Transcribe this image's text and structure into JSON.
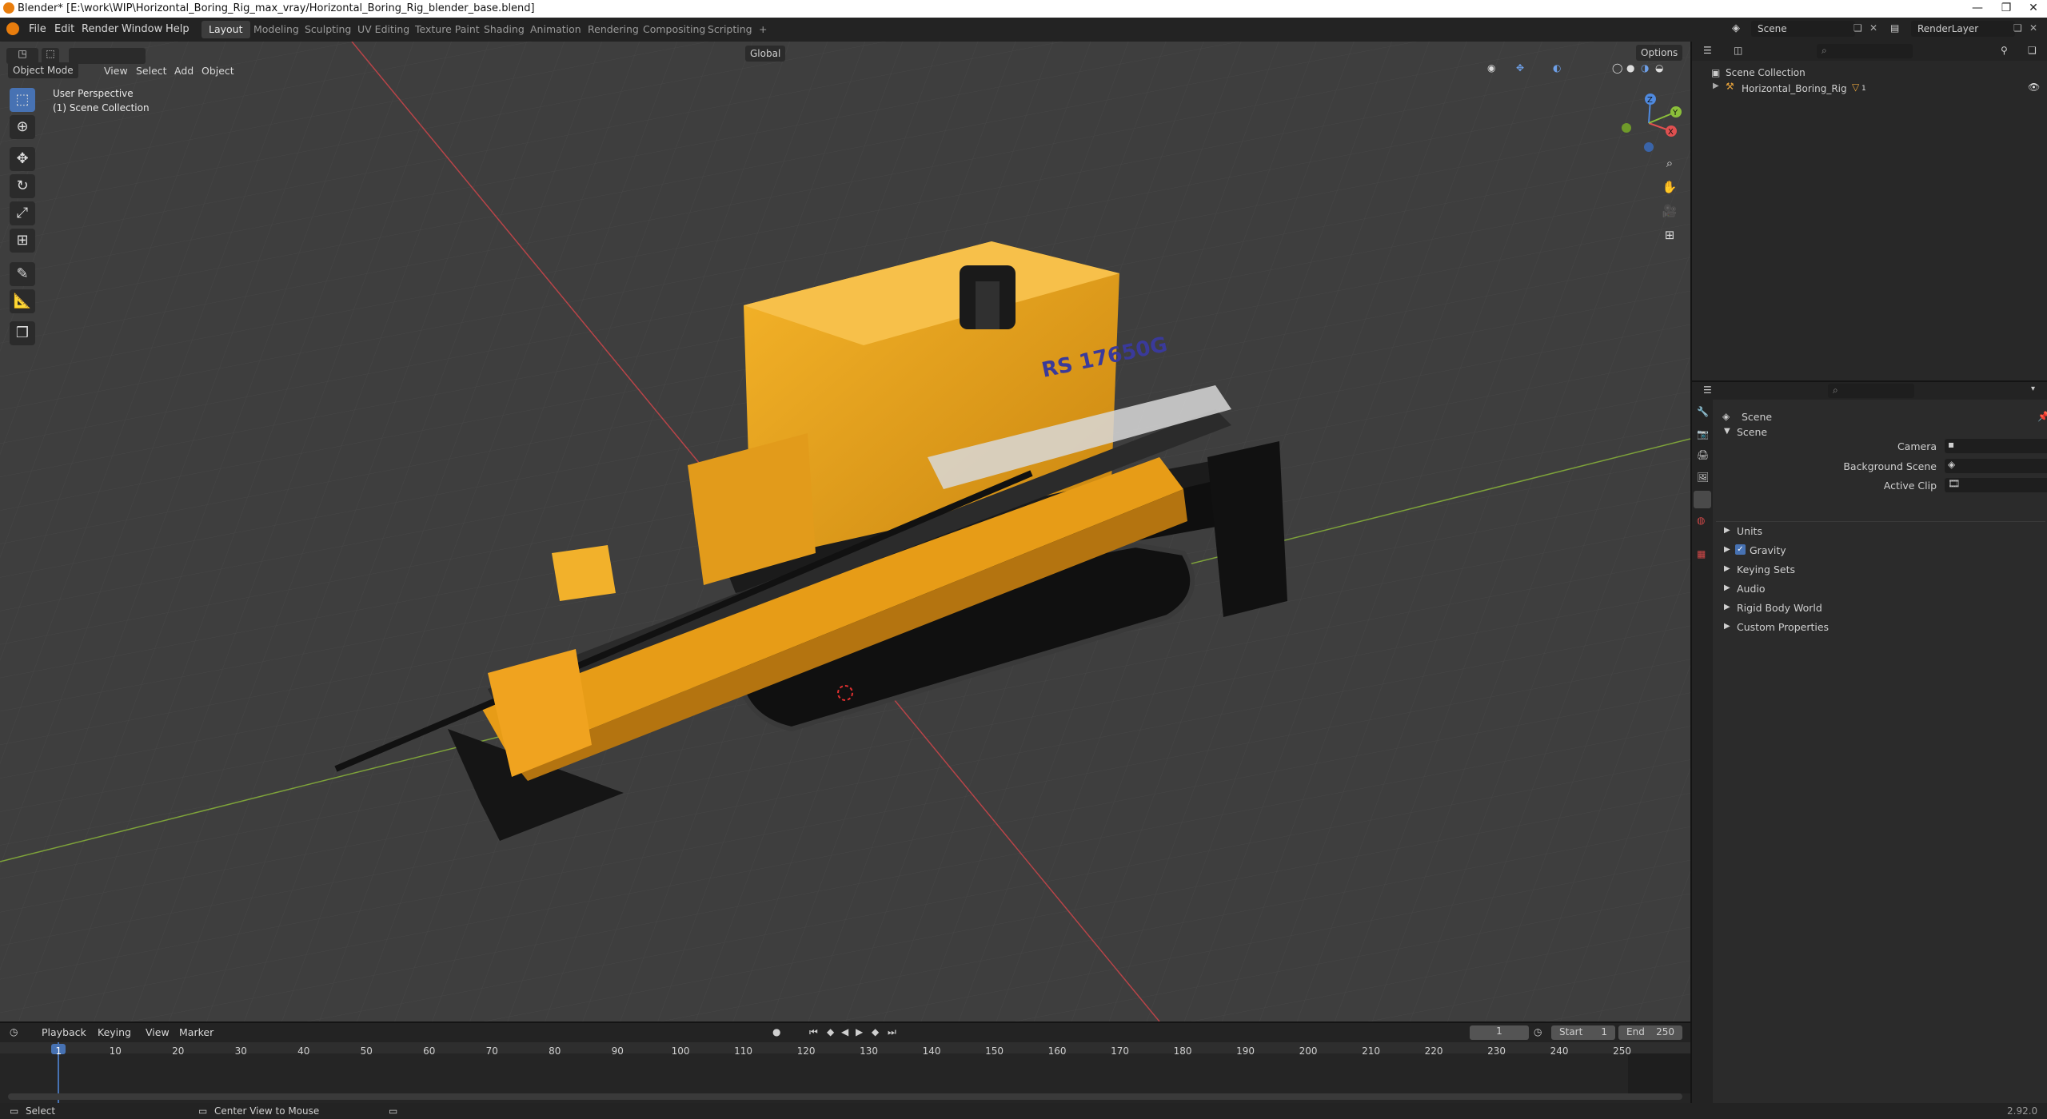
{
  "titlebar": {
    "title": "Blender* [E:\\work\\WIP\\Horizontal_Boring_Rig_max_vray/Horizontal_Boring_Rig_blender_base.blend]",
    "minimize": "—",
    "maximize": "❐",
    "close": "✕"
  },
  "menu": [
    "File",
    "Edit",
    "Render",
    "Window",
    "Help"
  ],
  "workspaces": [
    "Layout",
    "Modeling",
    "Sculpting",
    "UV Editing",
    "Texture Paint",
    "Shading",
    "Animation",
    "Rendering",
    "Compositing",
    "Scripting",
    "+"
  ],
  "scene_name": "Scene",
  "view_layer": "RenderLayer",
  "viewport": {
    "mode": "Object Mode",
    "menus": [
      "View",
      "Select",
      "Add",
      "Object"
    ],
    "orientation": "Global",
    "options": "Options",
    "info_line1": "User Perspective",
    "info_line2": "(1) Scene Collection",
    "model_label": "RS 17650G",
    "gizmo": {
      "x": "X",
      "y": "Y",
      "z": "Z"
    }
  },
  "outliner": {
    "root": "Scene Collection",
    "items": [
      "Horizontal_Boring_Rig"
    ],
    "badge": "1"
  },
  "properties": {
    "header": "Scene",
    "panel": "Scene",
    "camera_label": "Camera",
    "background_label": "Background Scene",
    "clip_label": "Active Clip",
    "sections": [
      "Units",
      "Gravity",
      "Keying Sets",
      "Audio",
      "Rigid Body World",
      "Custom Properties"
    ],
    "gravity_checked": true
  },
  "timeline": {
    "menus": [
      "Playback",
      "Keying",
      "View",
      "Marker"
    ],
    "current_frame": "1",
    "start_label": "Start",
    "start": "1",
    "end_label": "End",
    "end": "250",
    "ticks": [
      "1",
      "10",
      "20",
      "30",
      "40",
      "50",
      "60",
      "70",
      "80",
      "90",
      "100",
      "110",
      "120",
      "130",
      "140",
      "150",
      "160",
      "170",
      "180",
      "190",
      "200",
      "210",
      "220",
      "230",
      "240",
      "250"
    ]
  },
  "status": {
    "select": "Select",
    "center": "Center View to Mouse",
    "version": "2.92.0"
  },
  "colors": {
    "accent": "#4772b3",
    "rig_yellow": "#f2a81d",
    "x_axis": "#d9484a",
    "y_axis": "#8bbf3a"
  }
}
